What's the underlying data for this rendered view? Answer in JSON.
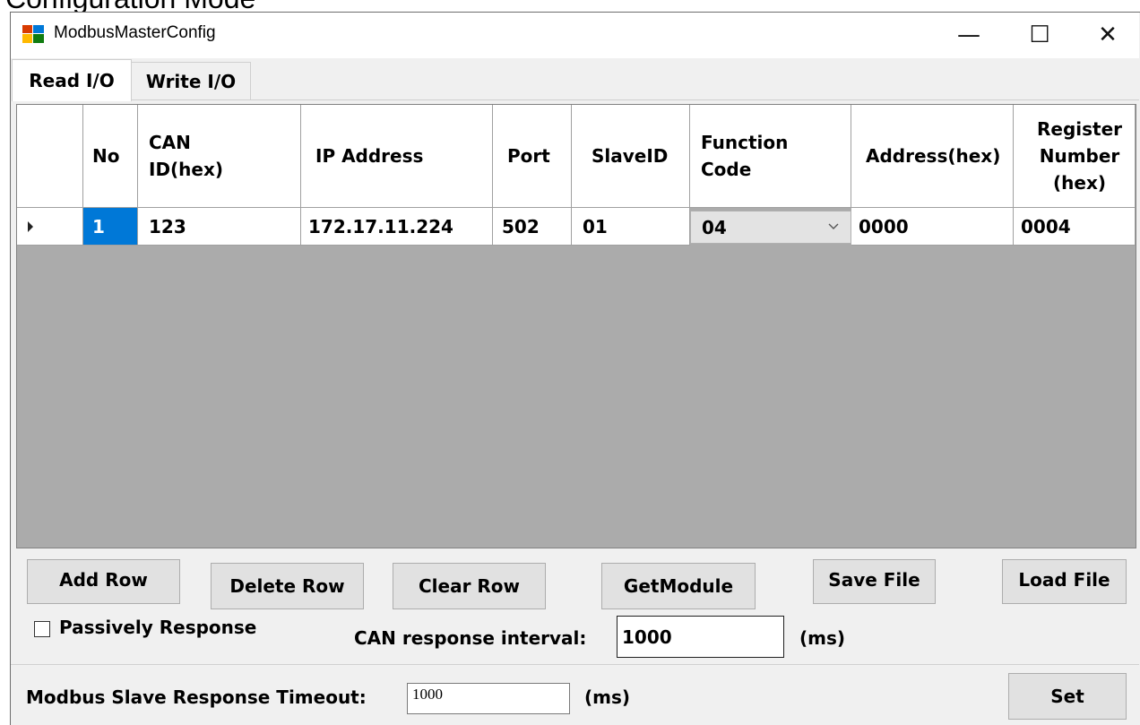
{
  "overhead_text": "Configuration Mode",
  "window": {
    "title": "ModbusMasterConfig"
  },
  "controls": {
    "minimize": "—",
    "maximize": "☐",
    "close": "✕"
  },
  "tabs": [
    {
      "label": "Read I/O",
      "active": true
    },
    {
      "label": "Write I/O",
      "active": false
    }
  ],
  "table": {
    "columns": [
      "No",
      "CAN ID(hex)",
      "IP Address",
      "Port",
      "SlaveID",
      "Function Code",
      "Address(hex)",
      "Register Number (hex)"
    ],
    "rows": [
      {
        "no": "1",
        "can_id": "123",
        "ip": "172.17.11.224",
        "port": "502",
        "slave_id": "01",
        "function_code": "04",
        "address": "0000",
        "register_number": "0004"
      }
    ]
  },
  "buttons": {
    "add_row": "Add Row",
    "delete_row": "Delete Row",
    "clear_row": "Clear Row",
    "get_module": "GetModule",
    "save_file": "Save File",
    "load_file": "Load File",
    "set": "Set"
  },
  "options": {
    "passively_response_label": "Passively Response",
    "passively_response_checked": false,
    "can_interval_label": "CAN response interval:",
    "can_interval_value": "1000",
    "can_interval_unit": "(ms)"
  },
  "footer": {
    "timeout_label": "Modbus Slave Response Timeout:",
    "timeout_value": "1000",
    "timeout_unit": "(ms)"
  }
}
